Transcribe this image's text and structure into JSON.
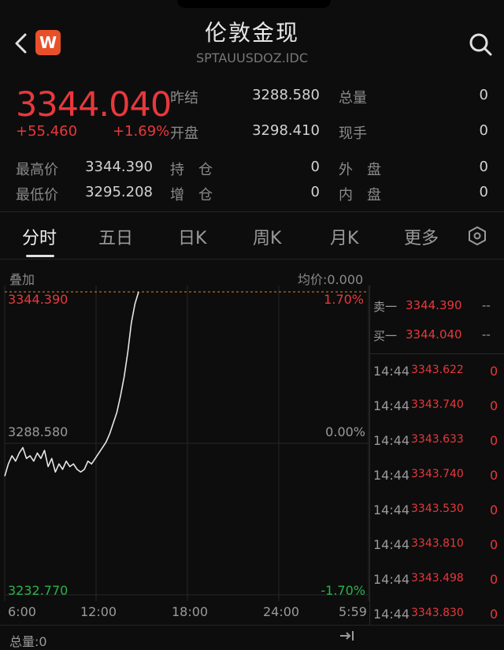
{
  "header": {
    "title": "伦敦金现",
    "subtitle": "SPTAUUSDOZ.IDC",
    "logo_text": "W",
    "logo_color": "#e8502a",
    "icons": [
      "back-arrow-icon",
      "search-icon"
    ]
  },
  "quote": {
    "price": "3344.040",
    "change": "+55.460",
    "change_pct": "+1.69%",
    "up_color": "#e8383b",
    "down_color": "#2bb24c",
    "fields": {
      "prev_close_label": "昨结",
      "prev_close": "3288.580",
      "volume_label": "总量",
      "volume": "0",
      "open_label": "开盘",
      "open": "3298.410",
      "current_hand_label": "现手",
      "current_hand": "0",
      "high_label": "最高价",
      "high": "3344.390",
      "open_interest_label": "持　仓",
      "open_interest": "0",
      "outer_label": "外　盘",
      "outer": "0",
      "low_label": "最低价",
      "low": "3295.208",
      "oi_change_label": "增　仓",
      "oi_change": "0",
      "inner_label": "内　盘",
      "inner": "0"
    }
  },
  "tabs": [
    "分时",
    "五日",
    "日K",
    "周K",
    "月K",
    "更多"
  ],
  "chart": {
    "overlay_label": "叠加",
    "avg_label": "均价:0.000",
    "top_price": "3344.390",
    "top_pct": "1.70%",
    "mid_price": "3288.580",
    "mid_pct": "0.00%",
    "bottom_price": "3232.770",
    "bottom_pct": "-1.70%",
    "x_ticks": [
      "6:00",
      "12:00",
      "18:00",
      "24:00",
      "5:59"
    ],
    "footer_label": "总量:0"
  },
  "chart_data": {
    "type": "line",
    "series": [
      {
        "values": [
          3276.5,
          3281,
          3284,
          3282,
          3285,
          3287,
          3283,
          3284,
          3282,
          3285,
          3283,
          3286,
          3280,
          3283,
          3278,
          3281,
          3279,
          3282,
          3280,
          3281,
          3279,
          3278,
          3279,
          3282,
          3281,
          3283,
          3285,
          3287,
          3289,
          3292,
          3296,
          3300,
          3306,
          3313,
          3322,
          3333,
          3340,
          3344.39
        ]
      }
    ],
    "ylim": [
      3232.77,
      3344.39
    ],
    "xlim": [
      0,
      240
    ],
    "points_end_x": 38,
    "grid": true
  },
  "trades": {
    "ask_label": "卖一",
    "ask_price": "3344.390",
    "ask_vol": "--",
    "bid_label": "买一",
    "bid_price": "3344.040",
    "bid_vol": "--",
    "rows": [
      {
        "time": "14:44",
        "price": "3343.622",
        "vol": "0"
      },
      {
        "time": "14:44",
        "price": "3343.740",
        "vol": "0"
      },
      {
        "time": "14:44",
        "price": "3343.633",
        "vol": "0"
      },
      {
        "time": "14:44",
        "price": "3343.740",
        "vol": "0"
      },
      {
        "time": "14:44",
        "price": "3343.530",
        "vol": "0"
      },
      {
        "time": "14:44",
        "price": "3343.810",
        "vol": "0"
      },
      {
        "time": "14:44",
        "price": "3343.498",
        "vol": "0"
      },
      {
        "time": "14:44",
        "price": "3343.830",
        "vol": "0"
      }
    ]
  }
}
